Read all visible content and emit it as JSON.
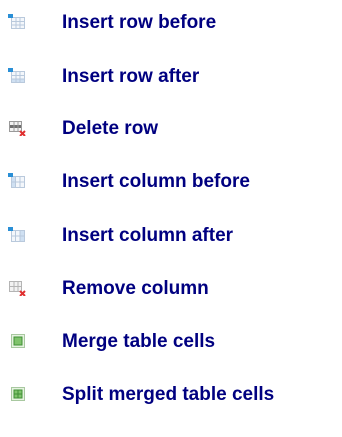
{
  "menu": {
    "items": [
      {
        "label": "Insert row before",
        "icon": "insert-row-before-icon"
      },
      {
        "label": "Insert row after",
        "icon": "insert-row-after-icon"
      },
      {
        "label": "Delete row",
        "icon": "delete-row-icon"
      },
      {
        "label": "Insert column before",
        "icon": "insert-column-before-icon"
      },
      {
        "label": "Insert column after",
        "icon": "insert-column-after-icon"
      },
      {
        "label": "Remove column",
        "icon": "remove-column-icon"
      },
      {
        "label": "Merge table cells",
        "icon": "merge-cells-icon"
      },
      {
        "label": "Split merged table cells",
        "icon": "split-cells-icon"
      }
    ]
  },
  "colors": {
    "label_text": "#000080",
    "grid_line": "#b9c9dc",
    "grid_fill": "#f4f7fb",
    "highlight_blue": "#8fb8e6",
    "insert_marker": "#2a8fd6",
    "delete_marker": "#e03030",
    "merge_green": "#7fc36b",
    "merge_green_dark": "#3f8f35"
  }
}
